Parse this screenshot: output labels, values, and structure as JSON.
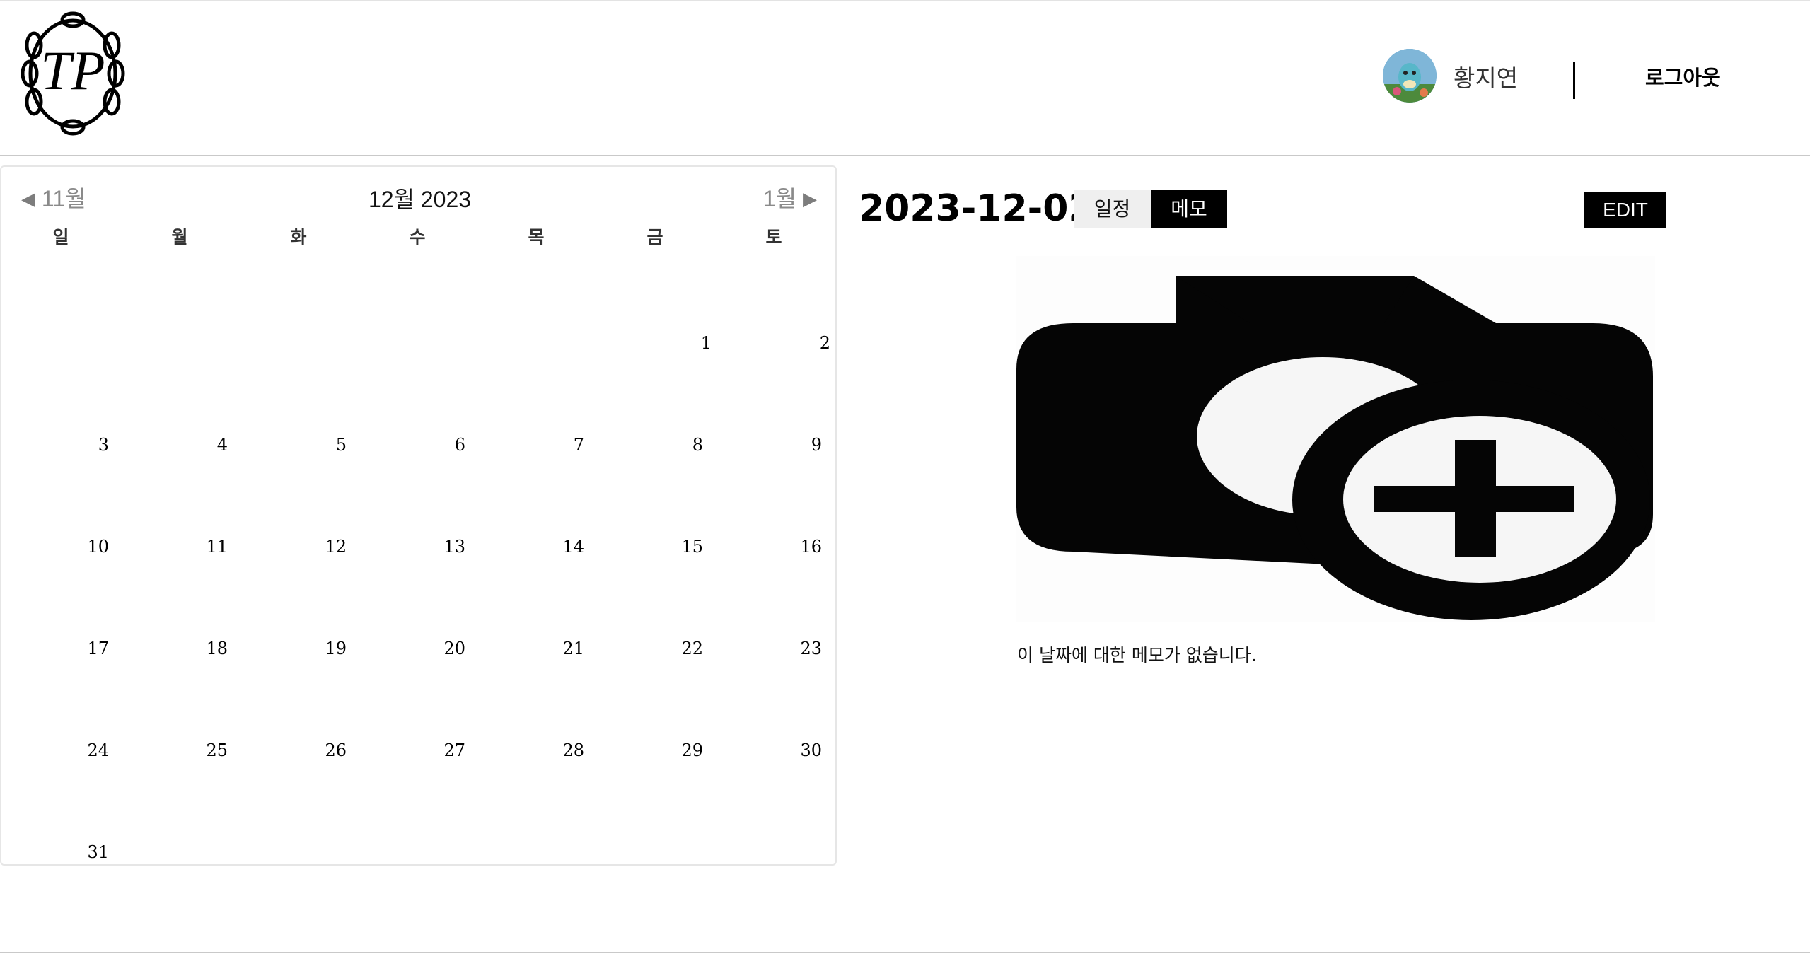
{
  "header": {
    "logo_text": "TP",
    "user_name": "황지연",
    "logout_label": "로그아웃"
  },
  "calendar": {
    "prev_label": "11월",
    "next_label": "1월",
    "title": "12월 2023",
    "weekdays": [
      "일",
      "월",
      "화",
      "수",
      "목",
      "금",
      "토"
    ],
    "weeks": [
      [
        "",
        "",
        "",
        "",
        "",
        "1",
        "2"
      ],
      [
        "3",
        "4",
        "5",
        "6",
        "7",
        "8",
        "9"
      ],
      [
        "10",
        "11",
        "12",
        "13",
        "14",
        "15",
        "16"
      ],
      [
        "17",
        "18",
        "19",
        "20",
        "21",
        "22",
        "23"
      ],
      [
        "24",
        "25",
        "26",
        "27",
        "28",
        "29",
        "30"
      ],
      [
        "31",
        "",
        "",
        "",
        "",
        "",
        ""
      ]
    ]
  },
  "detail": {
    "date": "2023-12-02",
    "tab_schedule": "일정",
    "tab_memo": "메모",
    "active_tab": "메모",
    "edit_label": "EDIT",
    "photo_icon": "add-photo-icon",
    "empty_memo": "이 날짜에 대한 메모가 없습니다."
  },
  "colors": {
    "accent": "#000000",
    "inactive_tab": "#efefef",
    "nav_gray": "#8a8a8a"
  }
}
